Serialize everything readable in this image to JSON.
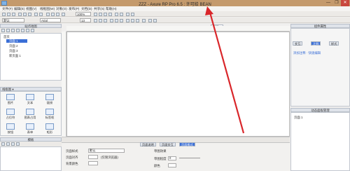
{
  "window": {
    "title": "ZZZ - Axure RP Pro 6.5 : 许可给 BEAN",
    "min": "—",
    "max": "❐",
    "close": "✕"
  },
  "menu": [
    "文件(F)",
    "编辑(E)",
    "视图(V)",
    "线框图(W)",
    "对象(O)",
    "发布(P)",
    "文档(D)",
    "共享(S)",
    "帮助(H)"
  ],
  "toolbar": {
    "zoom": "100%",
    "style": "默认",
    "font": "Arial",
    "size": "13"
  },
  "sitemap": {
    "header": "站点地图",
    "items": [
      "首页",
      "页面 1",
      "页面 2",
      "页面 3",
      "新页面 1"
    ]
  },
  "widgets": {
    "header": "线框图 ▾",
    "items": [
      "图片",
      "文本",
      "链接",
      "占位符",
      "图表占用",
      "标签框",
      "按钮",
      "表单",
      "矩形"
    ]
  },
  "masters": {
    "header": "模板"
  },
  "canvas": {
    "tab": "页面 1",
    "close": "✕"
  },
  "right": {
    "header": "组件属性",
    "tabs": [
      "交互",
      "注释",
      "样式"
    ],
    "row": "添加注释 · 快速编辑"
  },
  "dynamic": {
    "header": "动态面板管理",
    "item": "页面 1"
  },
  "bottom": {
    "tabs": [
      "页面说明",
      "页面交互",
      "页面格式"
    ],
    "labels": {
      "style": "页面样式",
      "align": "页面对齐",
      "bg": "背景颜色",
      "size": "草图效果",
      "size2": "草图程度",
      "color": "颜色"
    },
    "values": {
      "style": "默认",
      "align_opt": "(仅限浏览器)",
      "sketch": "0"
    }
  },
  "colors": {
    "title": "#c49a6c",
    "accent": "#3b6fd6",
    "arrow": "#d9262a"
  }
}
